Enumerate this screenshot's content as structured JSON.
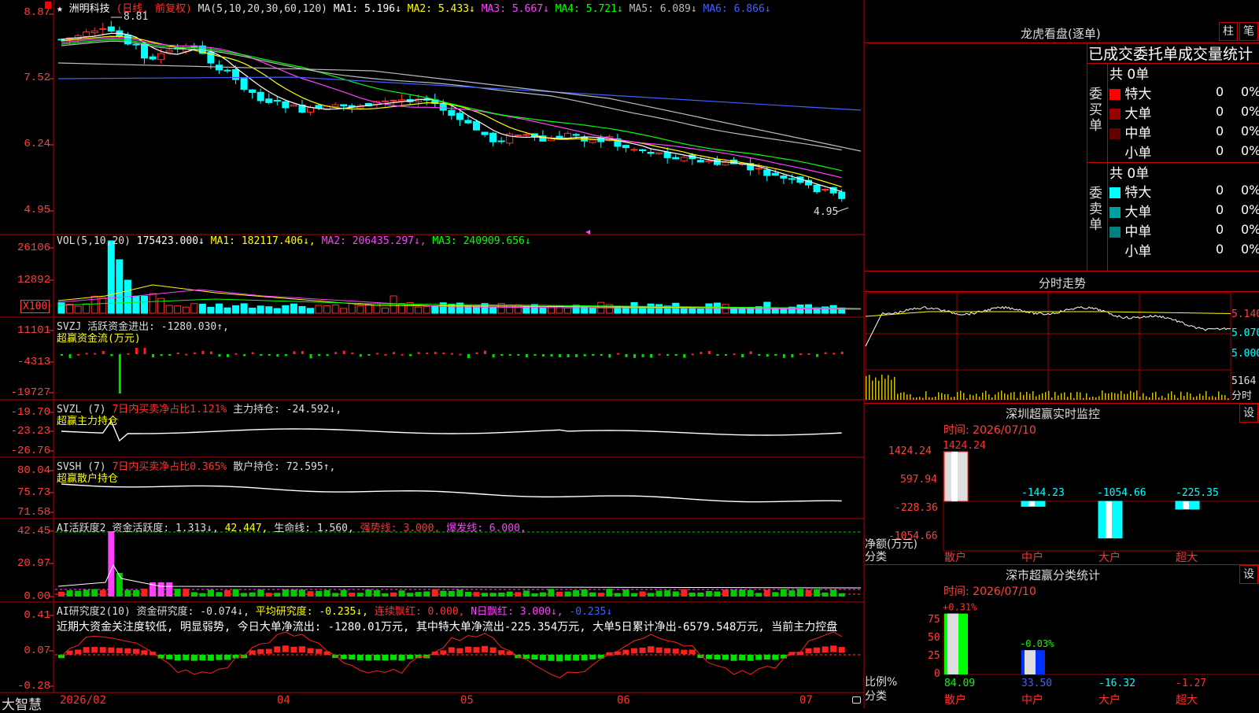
{
  "main_chart": {
    "stock_label": "★ 洲明科技",
    "period_label": "(日线, 前复权)",
    "ma_label": "MA(5,10,20,30,60,120)",
    "mas": [
      {
        "name": "MA1",
        "value": "5.196↓",
        "color": "#ffffff"
      },
      {
        "name": "MA2",
        "value": "5.433↓",
        "color": "#ffff00"
      },
      {
        "name": "MA3",
        "value": "5.667↓",
        "color": "#ff40ff"
      },
      {
        "name": "MA4",
        "value": "5.721↓",
        "color": "#00ff00"
      },
      {
        "name": "MA5",
        "value": "6.089↓",
        "color": "#bbbbbb"
      },
      {
        "name": "MA6",
        "value": "6.866↓",
        "color": "#4060ff"
      }
    ],
    "y_ticks": [
      "8.87",
      "7.52",
      "6.24",
      "4.95"
    ],
    "high_label": "8.81",
    "low_label": "4.95"
  },
  "vol_panel": {
    "title": "VOL(5,10,20)",
    "value": "175423.000↓",
    "ma1_label": "MA1:",
    "ma1": "182117.406↓",
    "ma2_label": "MA2:",
    "ma2": "206435.297↓",
    "ma3_label": "MA3:",
    "ma3": "240909.656↓",
    "y_ticks": [
      "26106",
      "12892"
    ],
    "unit": "X100"
  },
  "svzj_panel": {
    "title": "SVZJ",
    "desc": "活跃资金进出: -1280.030↑,",
    "sub": "超赢资金流(万元)",
    "y_ticks": [
      "11101",
      "-4313",
      "-19727"
    ]
  },
  "svzl_panel": {
    "title": "SVZL (7)",
    "ratio": "7日内买卖净占比1.121%",
    "hold": "主力持仓: -24.592↓,",
    "sub": "超赢主力持仓",
    "y_ticks": [
      "-19.70",
      "-23.23",
      "-26.76"
    ]
  },
  "svsh_panel": {
    "title": "SVSH (7)",
    "ratio": "7日内买卖净占比0.365%",
    "hold": "散户持仓: 72.595↑,",
    "sub": "超赢散户持仓",
    "y_ticks": [
      "80.04",
      "75.73",
      "71.58"
    ]
  },
  "ai_active_panel": {
    "title": "AI活跃度2",
    "p1": "资金活跃度: 1.313↓,",
    "p2": "42.447,",
    "p3": "生命线: 1.560,",
    "p4": "强势线: 3.000,",
    "p5": "爆发线: 6.000,",
    "y_ticks": [
      "42.45",
      "20.97",
      "0.00"
    ]
  },
  "ai_research_panel": {
    "title": "AI研究度2(10)",
    "p1": "资金研究度: -0.074↓,",
    "p2": "平均研究度: -0.235↓,",
    "p3": "连续飘红: 0.000,",
    "p4": "N日飘红: 3.000↓,",
    "p5": "-0.235↓",
    "commentary": "近期大资金关注度较低, 明显弱势, 今日大单净流出: -1280.01万元, 其中特大单净流出-225.354万元, 大单5日累计净出-6579.548万元, 当前主力控盘",
    "y_ticks": [
      "0.41",
      "0.07",
      "-0.28"
    ]
  },
  "x_axis": {
    "brand": "大智慧",
    "labels": [
      "2026/02",
      "04",
      "05",
      "06",
      "07"
    ]
  },
  "right_panel": {
    "dragon_title": "龙虎看盘(逐单)",
    "btn_column": "柱",
    "btn_pen": "笔",
    "stats_header": "已成交委托单成交量统计",
    "buy_section_label": "委买单",
    "sell_section_label": "委卖单",
    "buy_total": "共 0单",
    "sell_total": "共 0单",
    "buy_rows": [
      {
        "label": "特大",
        "count": "0",
        "pct": "0%",
        "color": "#ff0000"
      },
      {
        "label": "大单",
        "count": "0",
        "pct": "0%",
        "color": "#990000"
      },
      {
        "label": "中单",
        "count": "0",
        "pct": "0%",
        "color": "#660000"
      },
      {
        "label": "小单",
        "count": "0",
        "pct": "0%",
        "color": "#000000"
      }
    ],
    "sell_rows": [
      {
        "label": "特大",
        "count": "0",
        "pct": "0%",
        "color": "#00ffff"
      },
      {
        "label": "大单",
        "count": "0",
        "pct": "0%",
        "color": "#00a0a0"
      },
      {
        "label": "中单",
        "count": "0",
        "pct": "0%",
        "color": "#008080"
      },
      {
        "label": "小单",
        "count": "0",
        "pct": "0%",
        "color": "#000000"
      }
    ],
    "intraday_title": "分时走势",
    "intraday_ticks": [
      "5.140",
      "5.070",
      "5.000"
    ],
    "intraday_vol": "5164",
    "intraday_vol_unit": "分时",
    "monitor_title": "深圳超赢实时监控",
    "monitor_btn": "设",
    "monitor_time": "时间: 2026/07/10",
    "monitor_ticks": [
      "1424.24",
      "597.94",
      "-228.36",
      "-1054.66"
    ],
    "monitor_axis_label": "净额(万元)",
    "monitor_axis_sub": "分类",
    "monitor_bars": [
      {
        "category": "散户",
        "value": 1424.24,
        "label": "1424.24"
      },
      {
        "category": "中户",
        "value": -144.23,
        "label": "-144.23"
      },
      {
        "category": "大户",
        "value": -1054.66,
        "label": "-1054.66"
      },
      {
        "category": "超大",
        "value": -225.35,
        "label": "-225.35"
      }
    ],
    "class_title": "深市超赢分类统计",
    "class_btn": "设",
    "class_time": "时间: 2026/07/10",
    "class_ticks": [
      "75",
      "50",
      "25",
      "0"
    ],
    "class_axis_label": "比例%",
    "class_axis_sub": "分类",
    "class_bars": [
      {
        "category": "散户",
        "pct_label": "+0.31%",
        "value": "84.09",
        "ratio": 84.09
      },
      {
        "category": "中户",
        "pct_label": "-0.03%",
        "value": "33.50",
        "ratio": 33.5
      },
      {
        "category": "大户",
        "pct_label": "",
        "value": "-16.32",
        "ratio": 0
      },
      {
        "category": "超大",
        "pct_label": "",
        "value": "-1.27",
        "ratio": 0
      }
    ]
  }
}
